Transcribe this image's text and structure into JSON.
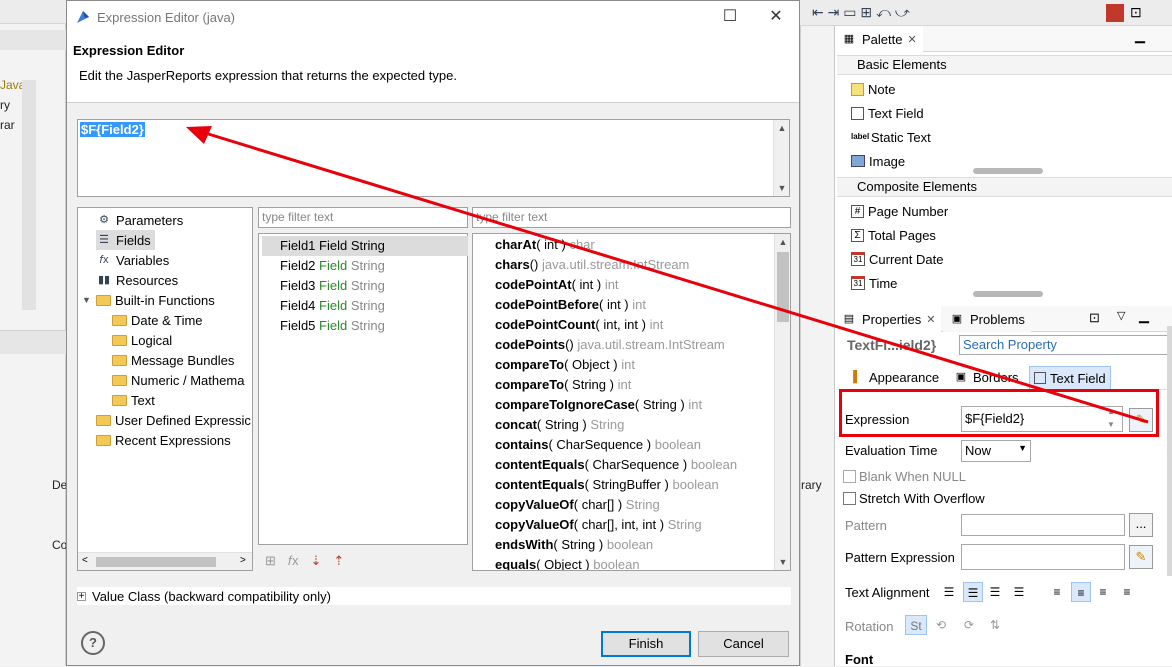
{
  "background": {
    "left_fragments": [
      "Java",
      "ry",
      "rar",
      "De",
      "Co"
    ],
    "mid_fragment": "rary"
  },
  "dialog": {
    "window_title": "Expression Editor (java)",
    "heading": "Expression Editor",
    "description": "Edit the JasperReports expression that returns the expected type.",
    "expression": "$F{Field2}",
    "categories": [
      {
        "label": "Parameters",
        "icon": "parameters-icon",
        "indent": 0
      },
      {
        "label": "Fields",
        "icon": "fields-icon",
        "indent": 0,
        "selected": true
      },
      {
        "label": "Variables",
        "icon": "variables-icon",
        "indent": 0
      },
      {
        "label": "Resources",
        "icon": "resources-icon",
        "indent": 0
      },
      {
        "label": "Built-in Functions",
        "icon": "folder-icon",
        "indent": 0,
        "expandable": true
      },
      {
        "label": "Date & Time",
        "icon": "folder-icon",
        "indent": 1
      },
      {
        "label": "Logical",
        "icon": "folder-icon",
        "indent": 1
      },
      {
        "label": "Message Bundles",
        "icon": "folder-icon",
        "indent": 1
      },
      {
        "label": "Numeric / Mathema",
        "icon": "folder-icon",
        "indent": 1
      },
      {
        "label": "Text",
        "icon": "folder-icon",
        "indent": 1
      },
      {
        "label": "User Defined Expressic",
        "icon": "folder-icon",
        "indent": 0
      },
      {
        "label": "Recent Expressions",
        "icon": "folder-icon",
        "indent": 0
      }
    ],
    "filter_placeholder": "type filter text",
    "fields": [
      {
        "name": "Field1",
        "kind": "Field",
        "type": "String",
        "selected": true
      },
      {
        "name": "Field2",
        "kind": "Field",
        "type": "String"
      },
      {
        "name": "Field3",
        "kind": "Field",
        "type": "String"
      },
      {
        "name": "Field4",
        "kind": "Field",
        "type": "String"
      },
      {
        "name": "Field5",
        "kind": "Field",
        "type": "String"
      }
    ],
    "methods": [
      {
        "name": "charAt",
        "args": "( int )",
        "ret": "char"
      },
      {
        "name": "chars",
        "args": "()",
        "ret": "java.util.stream.IntStream"
      },
      {
        "name": "codePointAt",
        "args": "( int )",
        "ret": "int"
      },
      {
        "name": "codePointBefore",
        "args": "( int )",
        "ret": "int"
      },
      {
        "name": "codePointCount",
        "args": "( int, int )",
        "ret": "int"
      },
      {
        "name": "codePoints",
        "args": "()",
        "ret": "java.util.stream.IntStream"
      },
      {
        "name": "compareTo",
        "args": "( Object )",
        "ret": "int"
      },
      {
        "name": "compareTo",
        "args": "( String )",
        "ret": "int"
      },
      {
        "name": "compareToIgnoreCase",
        "args": "( String )",
        "ret": "int"
      },
      {
        "name": "concat",
        "args": "( String )",
        "ret": "String"
      },
      {
        "name": "contains",
        "args": "( CharSequence )",
        "ret": "boolean"
      },
      {
        "name": "contentEquals",
        "args": "( CharSequence )",
        "ret": "boolean"
      },
      {
        "name": "contentEquals",
        "args": "( StringBuffer )",
        "ret": "boolean"
      },
      {
        "name": "copyValueOf",
        "args": "( char[] )",
        "ret": "String"
      },
      {
        "name": "copyValueOf",
        "args": "( char[], int, int )",
        "ret": "String"
      },
      {
        "name": "endsWith",
        "args": "( String )",
        "ret": "boolean"
      },
      {
        "name": "equals",
        "args": "( Object )",
        "ret": "boolean"
      }
    ],
    "value_class_label": "Value Class (backward compatibility only)",
    "finish_label": "Finish",
    "cancel_label": "Cancel",
    "help_glyph": "?"
  },
  "palette": {
    "tab_label": "Palette",
    "groups": [
      {
        "label": "Basic Elements",
        "items": [
          {
            "label": "Note",
            "icon": "note-icon"
          },
          {
            "label": "Text Field",
            "icon": "text-field-icon"
          },
          {
            "label": "Static Text",
            "icon": "static-text-icon"
          },
          {
            "label": "Image",
            "icon": "image-icon"
          }
        ]
      },
      {
        "label": "Composite Elements",
        "items": [
          {
            "label": "Page Number",
            "icon": "page-number-icon"
          },
          {
            "label": "Total Pages",
            "icon": "total-pages-icon"
          },
          {
            "label": "Current Date",
            "icon": "current-date-icon"
          },
          {
            "label": "Time",
            "icon": "time-icon"
          }
        ]
      }
    ],
    "static_text_icon_text": "label",
    "calendar_icon_text": "31"
  },
  "properties": {
    "tab_label": "Properties",
    "problems_tab_label": "Problems",
    "element_title": "TextFi...ield2}",
    "search_placeholder": "Search Property",
    "sub_tabs": [
      "Appearance",
      "Borders",
      "Text Field"
    ],
    "expression_label": "Expression",
    "expression_value": "$F{Field2}",
    "evaluation_time_label": "Evaluation Time",
    "evaluation_time_value": "Now",
    "blank_when_null_label": "Blank When NULL",
    "stretch_label": "Stretch With Overflow",
    "pattern_label": "Pattern",
    "pattern_button": "...",
    "pattern_expression_label": "Pattern Expression",
    "text_alignment_label": "Text Alignment",
    "rotation_label": "Rotation",
    "font_label": "Font"
  },
  "colors": {
    "annotation_red": "#e8000b",
    "selection_blue": "#3399ff",
    "field_kind_green": "#2a8a2a"
  }
}
